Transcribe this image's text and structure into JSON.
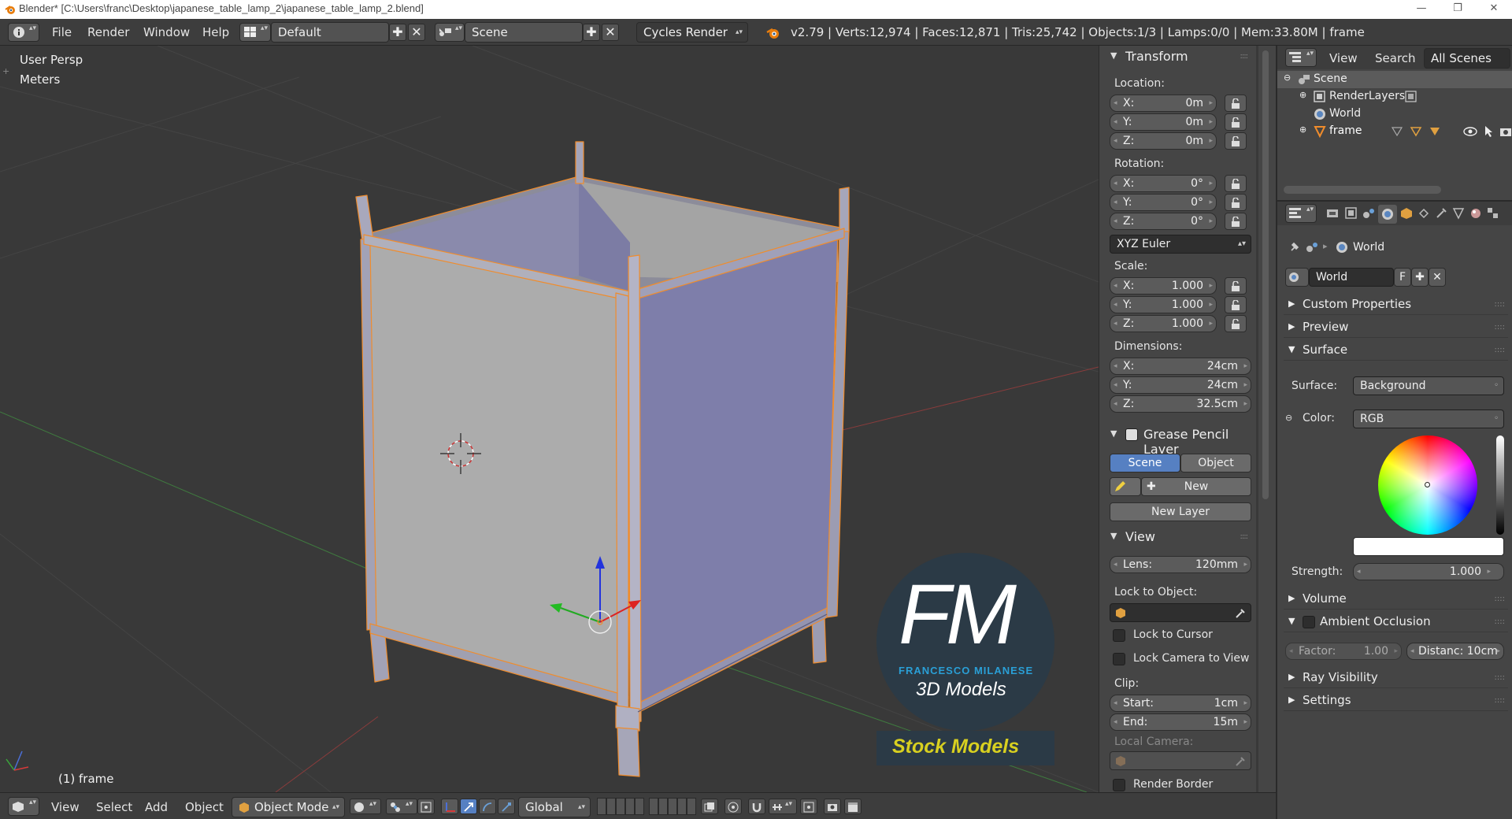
{
  "window": {
    "title": "Blender* [C:\\Users\\franc\\Desktop\\japanese_table_lamp_2\\japanese_table_lamp_2.blend]",
    "minimize": "—",
    "maximize": "❐",
    "close": "✕"
  },
  "infobar": {
    "menus": [
      "File",
      "Render",
      "Window",
      "Help"
    ],
    "screen_layout": "Default",
    "scene": "Scene",
    "render_engine": "Cycles Render",
    "stats": "v2.79 | Verts:12,974 | Faces:12,871 | Tris:25,742 | Objects:1/3 | Lamps:0/0 | Mem:33.80M | frame"
  },
  "viewport": {
    "view_name": "User Persp",
    "units": "Meters",
    "object_label": "(1) frame",
    "watermark": {
      "logo_letters": "FM",
      "author": "FRANCESCO MILANESE",
      "tagline": "3D Models",
      "stock": "Stock Models"
    }
  },
  "npanel": {
    "transform": {
      "title": "Transform",
      "location_label": "Location:",
      "location": [
        {
          "axis": "X:",
          "value": "0m"
        },
        {
          "axis": "Y:",
          "value": "0m"
        },
        {
          "axis": "Z:",
          "value": "0m"
        }
      ],
      "rotation_label": "Rotation:",
      "rotation": [
        {
          "axis": "X:",
          "value": "0°"
        },
        {
          "axis": "Y:",
          "value": "0°"
        },
        {
          "axis": "Z:",
          "value": "0°"
        }
      ],
      "rotation_mode": "XYZ Euler",
      "scale_label": "Scale:",
      "scale": [
        {
          "axis": "X:",
          "value": "1.000"
        },
        {
          "axis": "Y:",
          "value": "1.000"
        },
        {
          "axis": "Z:",
          "value": "1.000"
        }
      ],
      "dimensions_label": "Dimensions:",
      "dimensions": [
        {
          "axis": "X:",
          "value": "24cm"
        },
        {
          "axis": "Y:",
          "value": "24cm"
        },
        {
          "axis": "Z:",
          "value": "32.5cm"
        }
      ]
    },
    "grease_pencil": {
      "title": "Grease Pencil Layer",
      "tab_scene": "Scene",
      "tab_object": "Object",
      "new_label": "New",
      "new_layer_label": "New Layer"
    },
    "view": {
      "title": "View",
      "lens_label": "Lens:",
      "lens_value": "120mm",
      "lock_to_object_label": "Lock to Object:",
      "lock_to_cursor": "Lock to Cursor",
      "lock_camera": "Lock Camera to View",
      "clip_label": "Clip:",
      "clip_start_label": "Start:",
      "clip_start": "1cm",
      "clip_end_label": "End:",
      "clip_end": "15m",
      "local_camera_label": "Local Camera:",
      "render_border": "Render Border"
    }
  },
  "outliner": {
    "menu_view": "View",
    "menu_search": "Search",
    "filter": "All Scenes",
    "items": [
      {
        "label": "Scene"
      },
      {
        "label": "RenderLayers"
      },
      {
        "label": "World"
      },
      {
        "label": "frame"
      }
    ]
  },
  "properties": {
    "breadcrumb": "World",
    "world_name": "World",
    "fake_user": "F",
    "panels": {
      "custom_properties": "Custom Properties",
      "preview": "Preview",
      "surface": "Surface",
      "volume": "Volume",
      "ambient_occlusion": "Ambient Occlusion",
      "ray_visibility": "Ray Visibility",
      "settings": "Settings"
    },
    "surface_label": "Surface:",
    "surface_value": "Background",
    "color_label": "Color:",
    "color_value": "RGB",
    "strength_label": "Strength:",
    "strength_value": "1.000",
    "ao_factor_label": "Factor:",
    "ao_factor_value": "1.00",
    "ao_distance": "Distanc: 10cm"
  },
  "bottombar": {
    "menus": [
      "View",
      "Select",
      "Add",
      "Object"
    ],
    "mode": "Object Mode",
    "orientation": "Global"
  },
  "colors": {
    "selection_outline": "#f08c2c",
    "active_tab": "#5680c2",
    "watermark_blue": "#2a9fd6",
    "stock_yellow": "#d8d020"
  }
}
